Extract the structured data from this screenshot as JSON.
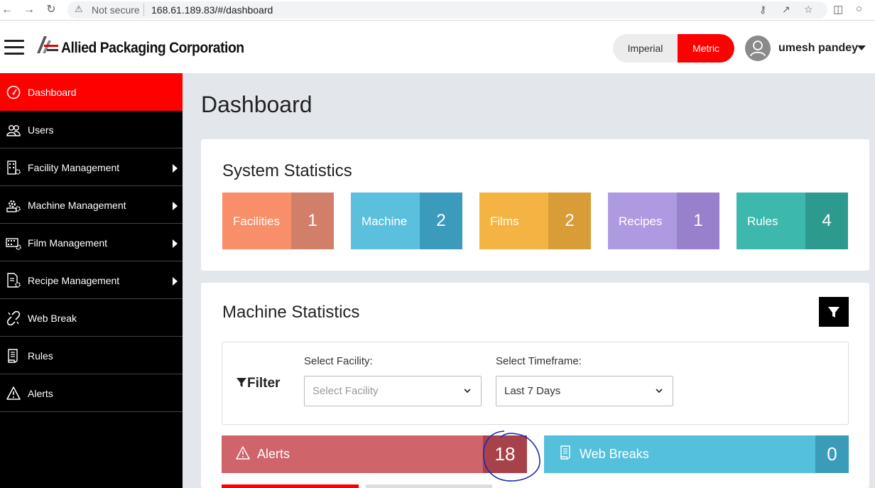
{
  "browser": {
    "security_label": "Not secure",
    "url": "168.61.189.83/#/dashboard"
  },
  "header": {
    "company": "Allied Packaging Corporation",
    "units": {
      "imperial": "Imperial",
      "metric": "Metric",
      "selected": "Metric"
    },
    "user_name": "umesh pandey"
  },
  "sidebar": {
    "items": [
      {
        "label": "Dashboard",
        "icon": "gauge-icon",
        "active": true,
        "submenu": false
      },
      {
        "label": "Users",
        "icon": "users-icon",
        "active": false,
        "submenu": false
      },
      {
        "label": "Facility Management",
        "icon": "building-gear-icon",
        "active": false,
        "submenu": true
      },
      {
        "label": "Machine Management",
        "icon": "machine-gear-icon",
        "active": false,
        "submenu": true
      },
      {
        "label": "Film Management",
        "icon": "film-gear-icon",
        "active": false,
        "submenu": true
      },
      {
        "label": "Recipe Management",
        "icon": "document-gear-icon",
        "active": false,
        "submenu": true
      },
      {
        "label": "Web Break",
        "icon": "broken-link-icon",
        "active": false,
        "submenu": false
      },
      {
        "label": "Rules",
        "icon": "rules-doc-icon",
        "active": false,
        "submenu": false
      },
      {
        "label": "Alerts",
        "icon": "warning-icon",
        "active": false,
        "submenu": false
      }
    ]
  },
  "main": {
    "page_title": "Dashboard",
    "system_statistics": {
      "title": "System Statistics",
      "tiles": [
        {
          "label": "Facilities",
          "count": "1",
          "color": "#f98f6a",
          "count_color": "#d27f6a"
        },
        {
          "label": "Machine",
          "count": "2",
          "color": "#5bc0de",
          "count_color": "#3b9bbd"
        },
        {
          "label": "Films",
          "count": "2",
          "color": "#f4b443",
          "count_color": "#d89d36"
        },
        {
          "label": "Recipes",
          "count": "1",
          "color": "#ae9ae0",
          "count_color": "#9880cc"
        },
        {
          "label": "Rules",
          "count": "4",
          "color": "#3db8ad",
          "count_color": "#2d9a90"
        }
      ]
    },
    "machine_statistics": {
      "title": "Machine Statistics",
      "filter": {
        "title": "Filter",
        "facility_label": "Select Facility:",
        "facility_placeholder": "Select Facility",
        "timeframe_label": "Select Timeframe:",
        "timeframe_value": "Last 7 Days"
      },
      "alerts": {
        "label": "Alerts",
        "count": "18",
        "color": "#cf646b",
        "count_color": "#a8424a"
      },
      "web_breaks": {
        "label": "Web Breaks",
        "count": "0",
        "color": "#54c0db",
        "count_color": "#3a9cb8"
      }
    }
  }
}
